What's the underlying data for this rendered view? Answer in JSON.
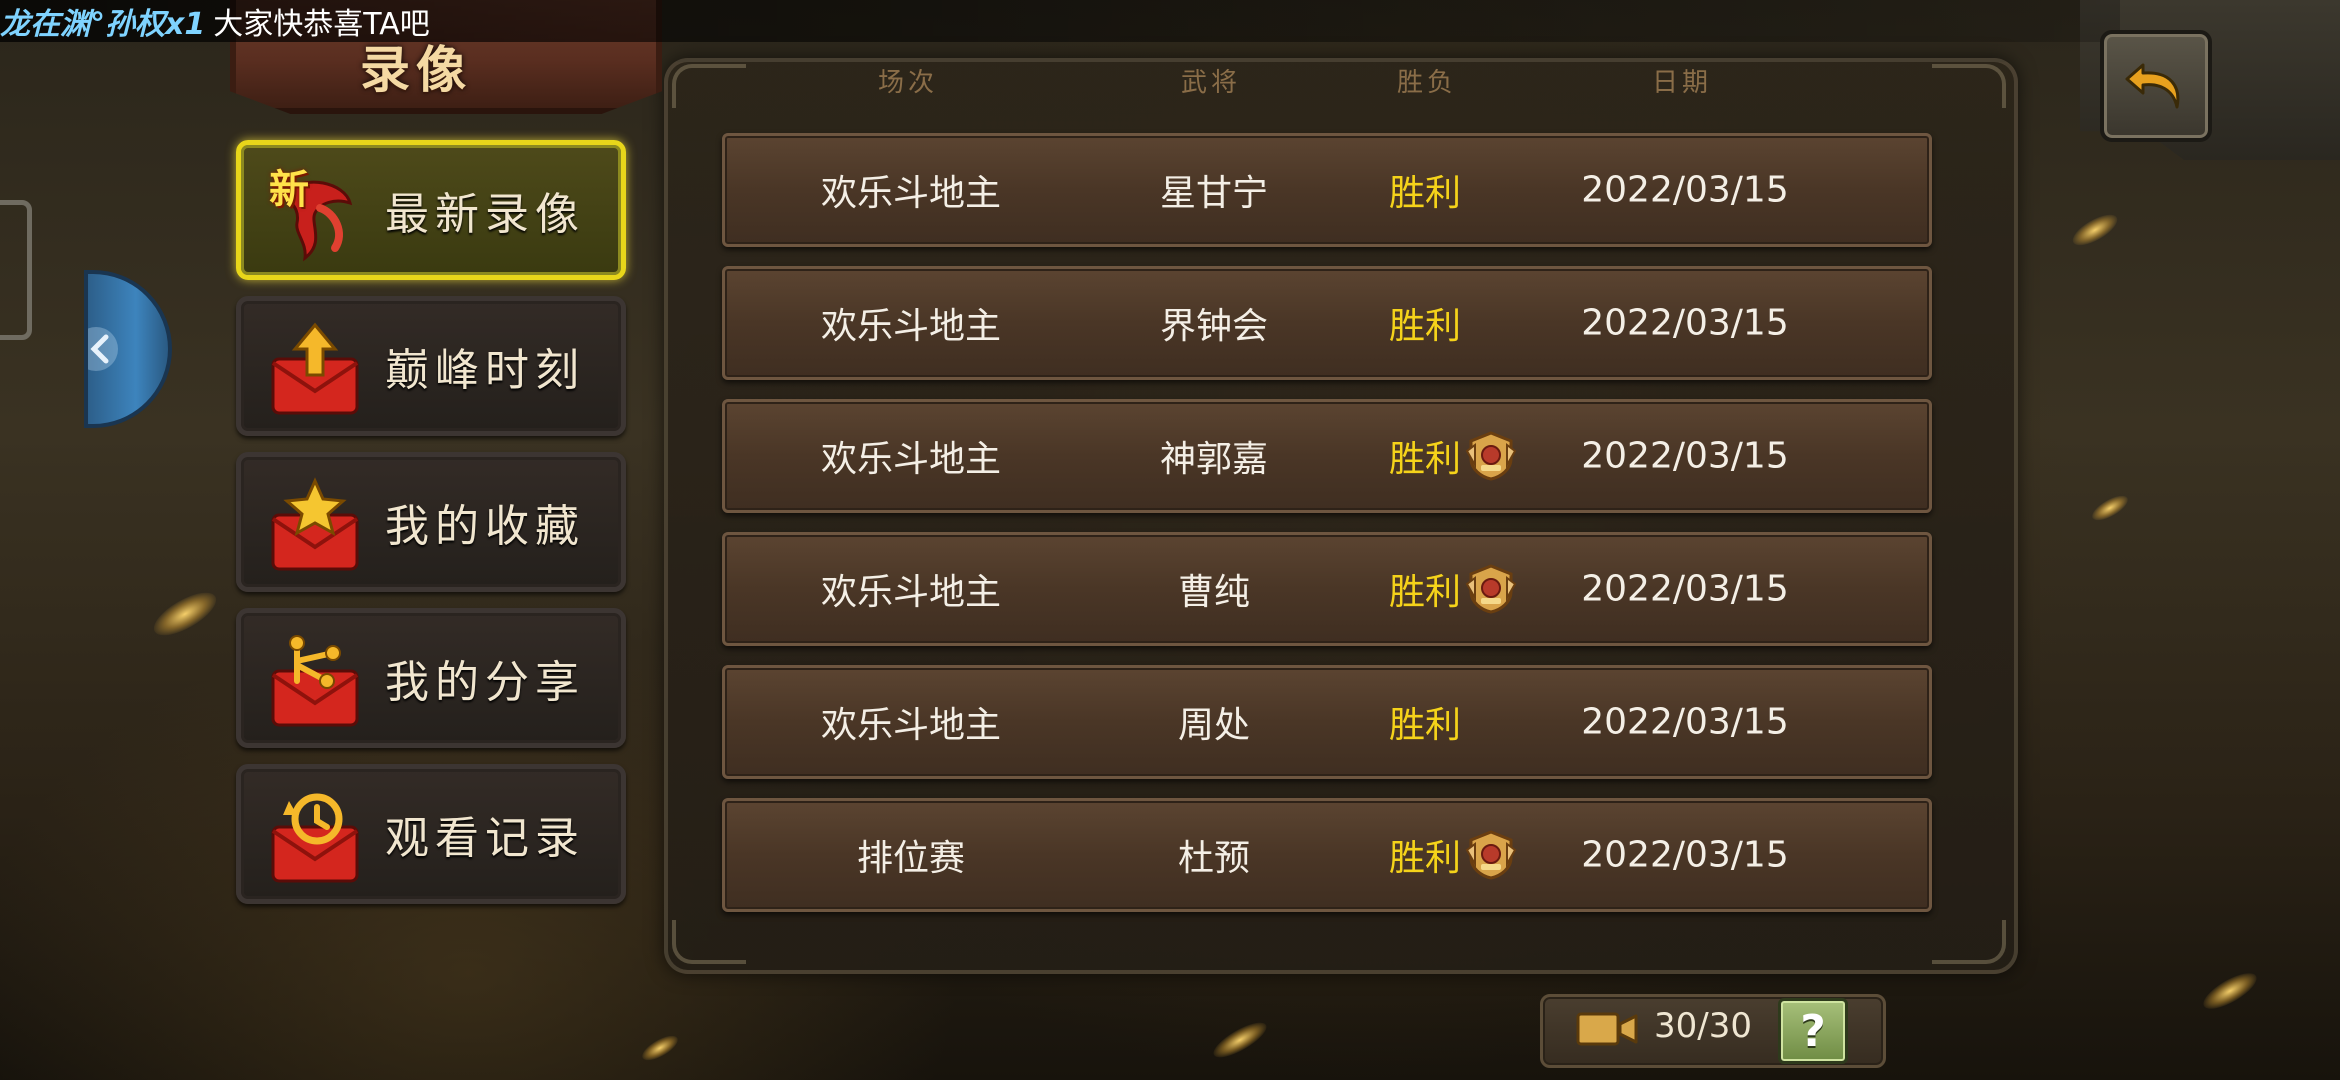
{
  "marquee": {
    "player": "龙在渊°孙权x1",
    "message": "大家快恭喜TA吧"
  },
  "page_title": "录像",
  "menu": {
    "items": [
      {
        "label": "最新录像",
        "icon": "new-ribbon-icon",
        "active": true,
        "badge": "新"
      },
      {
        "label": "巅峰时刻",
        "icon": "peak-envelope-icon",
        "active": false
      },
      {
        "label": "我的收藏",
        "icon": "star-envelope-icon",
        "active": false
      },
      {
        "label": "我的分享",
        "icon": "share-envelope-icon",
        "active": false
      },
      {
        "label": "观看记录",
        "icon": "history-envelope-icon",
        "active": false
      }
    ]
  },
  "table": {
    "headers": {
      "mode": "场次",
      "general": "武将",
      "result": "胜负",
      "date": "日期"
    },
    "rows": [
      {
        "mode": "欢乐斗地主",
        "general": "星甘宁",
        "result": "胜利",
        "mvp_badge": false,
        "date": "2022/03/15"
      },
      {
        "mode": "欢乐斗地主",
        "general": "界钟会",
        "result": "胜利",
        "mvp_badge": false,
        "date": "2022/03/15"
      },
      {
        "mode": "欢乐斗地主",
        "general": "神郭嘉",
        "result": "胜利",
        "mvp_badge": true,
        "date": "2022/03/15"
      },
      {
        "mode": "欢乐斗地主",
        "general": "曹纯",
        "result": "胜利",
        "mvp_badge": true,
        "date": "2022/03/15"
      },
      {
        "mode": "欢乐斗地主",
        "general": "周处",
        "result": "胜利",
        "mvp_badge": false,
        "date": "2022/03/15"
      },
      {
        "mode": "排位赛",
        "general": "杜预",
        "result": "胜利",
        "mvp_badge": true,
        "date": "2022/03/15"
      }
    ]
  },
  "footer": {
    "counter": "30/30",
    "help_label": "?"
  },
  "colors": {
    "win": "#f5d31a",
    "active_border": "#e8d61a",
    "marquee_name": "#7fd3ff"
  }
}
